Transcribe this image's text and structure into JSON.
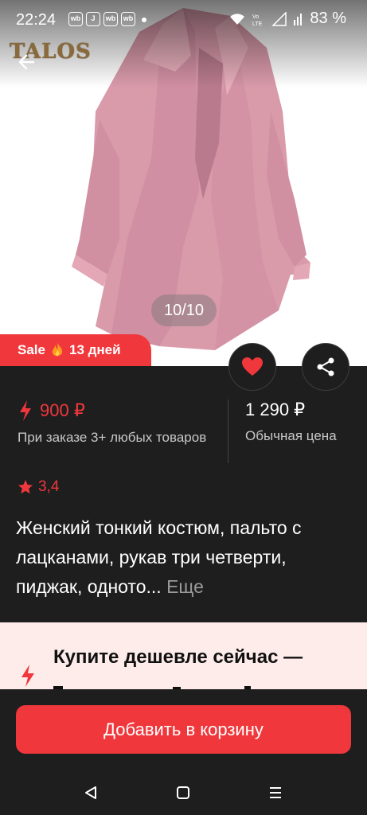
{
  "status_bar": {
    "time": "22:24",
    "apps": [
      "wb",
      "J",
      "wb",
      "wb"
    ],
    "battery": "83 %"
  },
  "hero": {
    "brand_logo": "TALOS",
    "image_counter": "10/10",
    "image_icon": "pink-jacket-photo"
  },
  "sale": {
    "label": "Sale",
    "icon": "fire-icon",
    "duration": "13 дней"
  },
  "price": {
    "promo_price": "900 ₽",
    "promo_note": "При заказе 3+ любых товаров",
    "regular_price": "1 290 ₽",
    "regular_label": "Обычная цена"
  },
  "rating": {
    "value": "3,4"
  },
  "product": {
    "title": "Женский тонкий костюм, пальто с лацканами, рукав три четверти, пиджак, одното...",
    "more": "Еще"
  },
  "promo": {
    "text": "Купите дешевле сейчас —"
  },
  "actions": {
    "add_to_cart": "Добавить в корзину"
  },
  "colors": {
    "accent": "#f0373c",
    "background": "#1e1e1e",
    "promo_bg": "#fdecea"
  }
}
